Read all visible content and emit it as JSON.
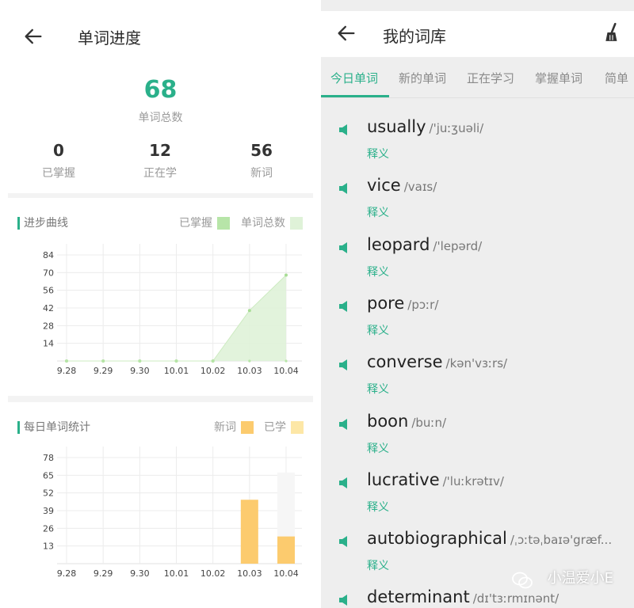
{
  "colors": {
    "accent": "#2ab08a",
    "mastered": "#b7e5a8",
    "total": "#dff2d8",
    "new_words": "#fccb6e",
    "learned": "#fde7a6"
  },
  "progress_page": {
    "title": "单词进度",
    "total": {
      "value": "68",
      "label": "单词总数"
    },
    "stats": [
      {
        "value": "0",
        "label": "已掌握"
      },
      {
        "value": "12",
        "label": "正在学"
      },
      {
        "value": "56",
        "label": "新词"
      }
    ],
    "progress_chart": {
      "title": "进步曲线",
      "legend": [
        "已掌握",
        "单词总数"
      ]
    },
    "daily_chart": {
      "title": "每日单词统计",
      "legend": [
        "新词",
        "已学"
      ]
    }
  },
  "chart_data": [
    {
      "type": "area",
      "title": "进步曲线",
      "x": [
        "9.28",
        "9.29",
        "9.30",
        "10.01",
        "10.02",
        "10.03",
        "10.04"
      ],
      "yticks": [
        14,
        28,
        42,
        56,
        70,
        84
      ],
      "ylim": [
        0,
        84
      ],
      "grid": true,
      "legend_position": "top-right",
      "series": [
        {
          "name": "已掌握",
          "values": [
            0,
            0,
            0,
            0,
            0,
            0,
            0
          ]
        },
        {
          "name": "单词总数",
          "values": [
            0,
            0,
            0,
            0,
            0,
            40,
            68
          ]
        }
      ]
    },
    {
      "type": "bar",
      "title": "每日单词统计",
      "categories": [
        "9.28",
        "9.29",
        "9.30",
        "10.01",
        "10.02",
        "10.03",
        "10.04"
      ],
      "yticks": [
        13,
        26,
        39,
        52,
        65,
        78
      ],
      "ylim": [
        0,
        78
      ],
      "grid": true,
      "legend_position": "top-right",
      "series": [
        {
          "name": "新词",
          "values": [
            0,
            0,
            0,
            0,
            0,
            47,
            20
          ]
        },
        {
          "name": "已学",
          "values": [
            0,
            0,
            0,
            0,
            0,
            0,
            67
          ]
        }
      ]
    }
  ],
  "library_page": {
    "title": "我的词库",
    "tabs": [
      "今日单词",
      "新的单词",
      "正在学习",
      "掌握单词",
      "简单"
    ],
    "meaning_label": "释义",
    "words": [
      {
        "word": "usually",
        "phonetic": "/'juːʒuəli/"
      },
      {
        "word": "vice",
        "phonetic": "/vaɪs/"
      },
      {
        "word": "leopard",
        "phonetic": "/'lepərd/"
      },
      {
        "word": "pore",
        "phonetic": "/pɔːr/"
      },
      {
        "word": "converse",
        "phonetic": "/kən'vɜːrs/"
      },
      {
        "word": "boon",
        "phonetic": "/buːn/"
      },
      {
        "word": "lucrative",
        "phonetic": "/'luːkrətɪv/"
      },
      {
        "word": "autobiographical",
        "phonetic": "/ˌɔːtəˌbaɪə'græf..."
      },
      {
        "word": "determinant",
        "phonetic": "/dɪ'tɜːrmɪnənt/"
      }
    ]
  },
  "watermark": "小温爱小E"
}
